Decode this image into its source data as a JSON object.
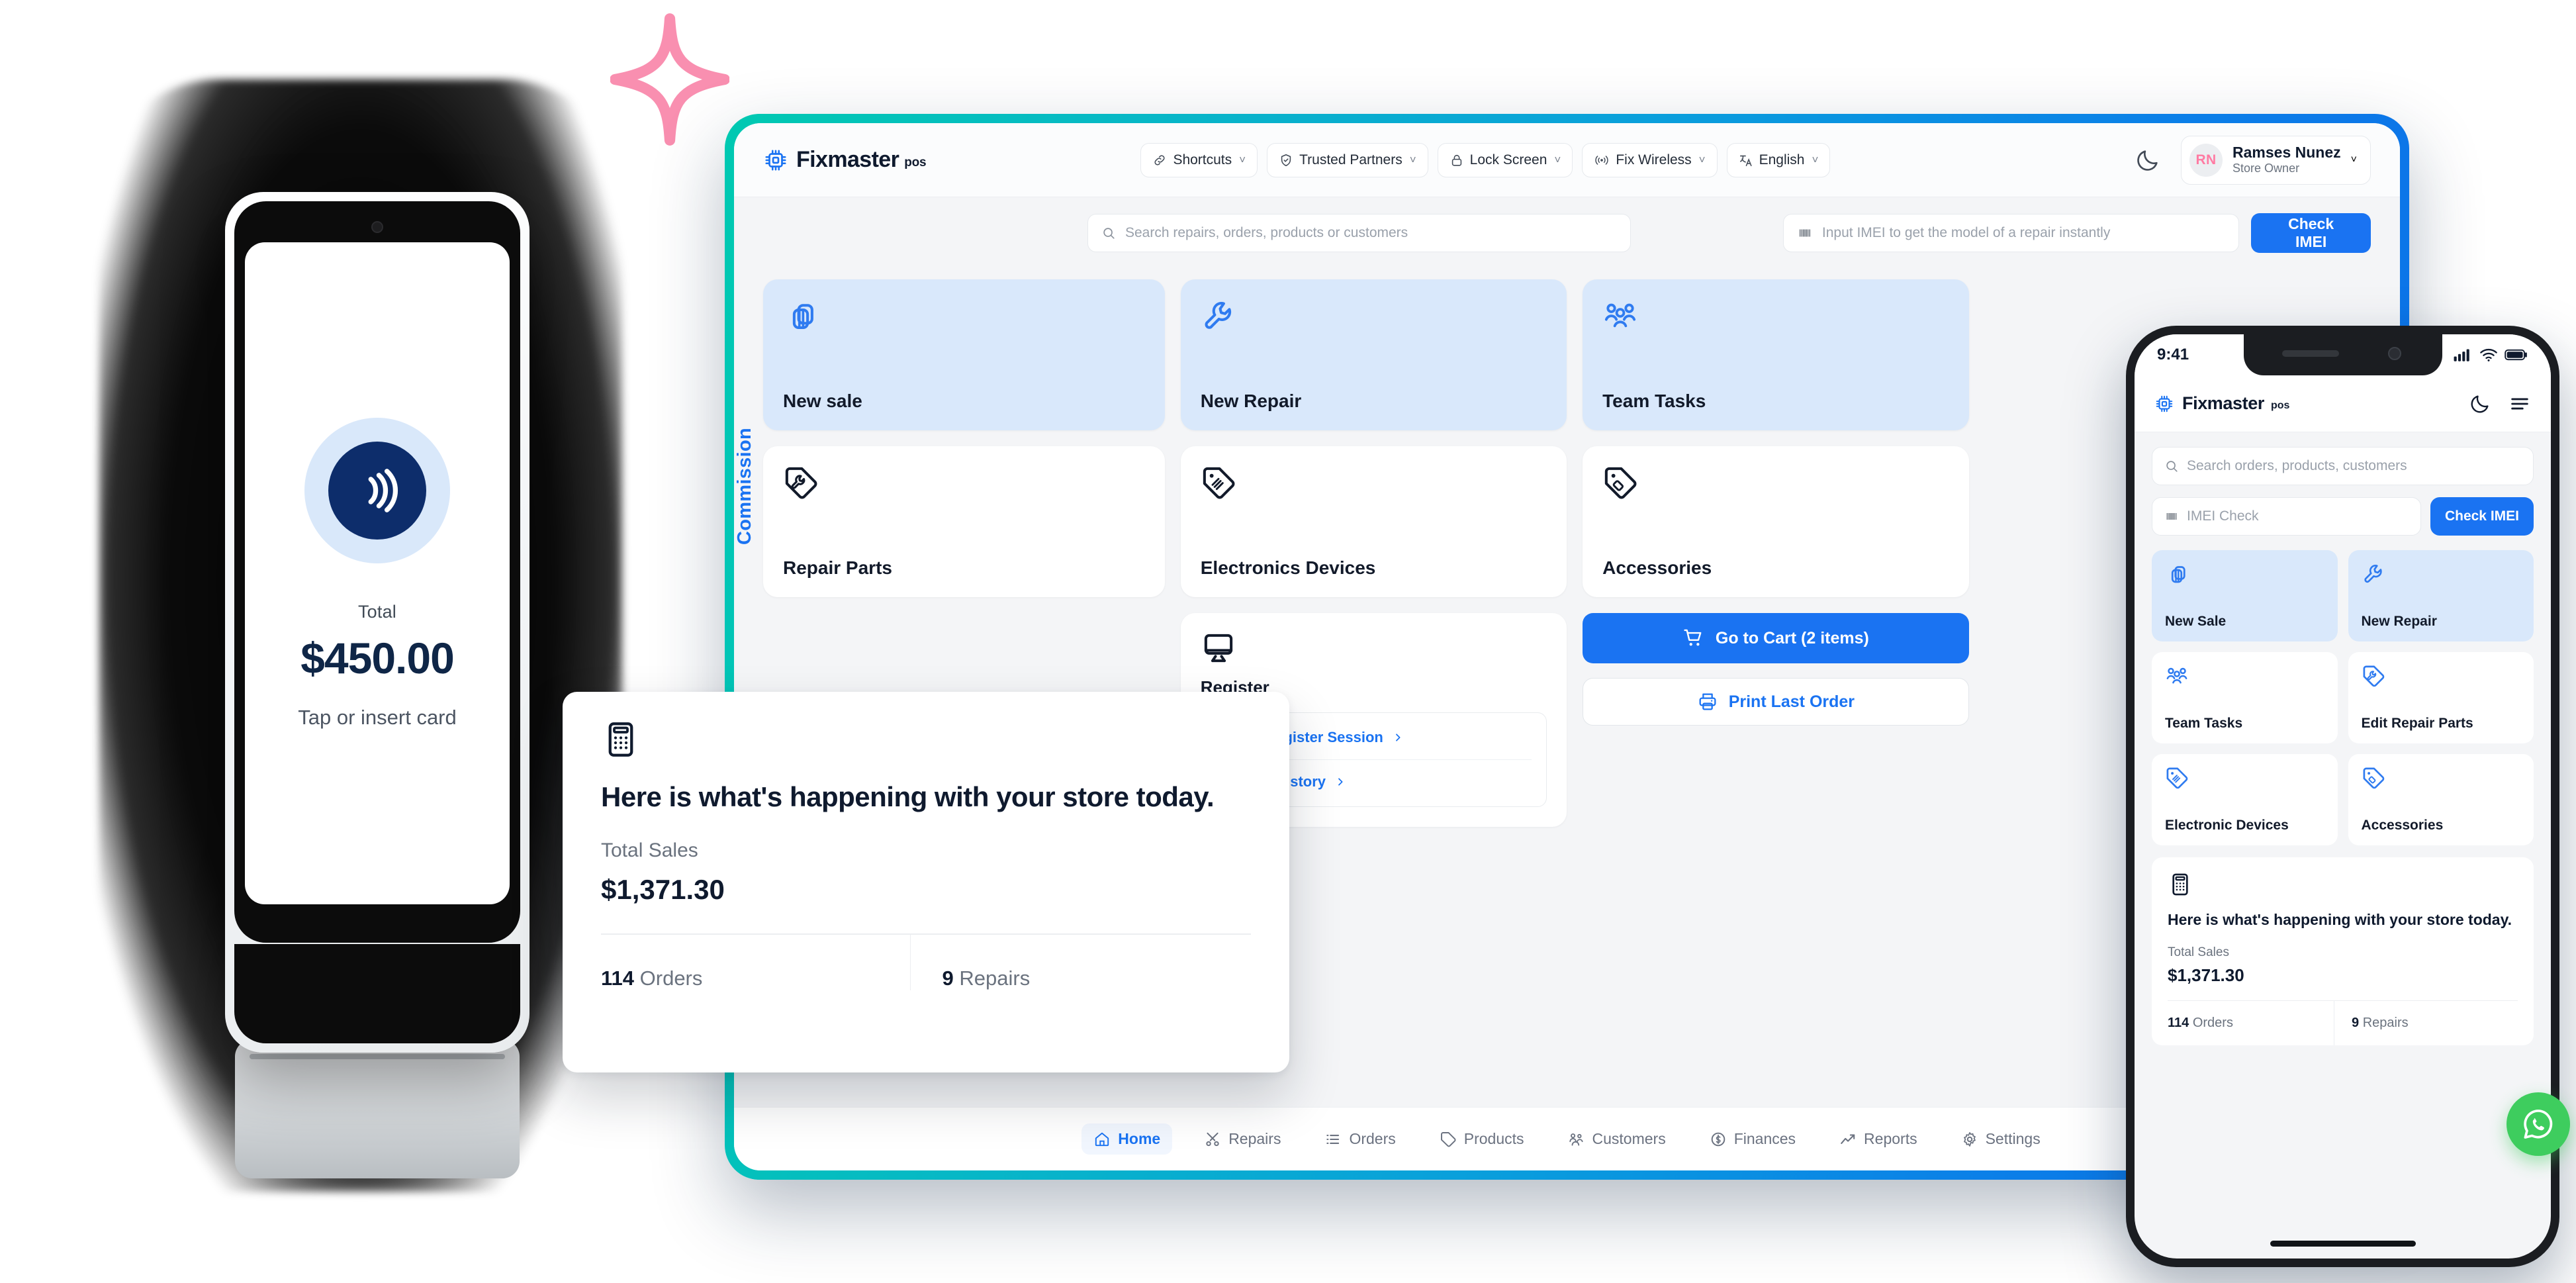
{
  "brand": {
    "name": "Fixmaster",
    "suffix": "pos"
  },
  "tablet": {
    "topnav": [
      {
        "label": "Shortcuts",
        "icon": "link-icon"
      },
      {
        "label": "Trusted Partners",
        "icon": "shield-check-icon"
      },
      {
        "label": "Lock Screen",
        "icon": "lock-icon"
      },
      {
        "label": "Fix Wireless",
        "icon": "wireless-signal-icon"
      },
      {
        "label": "English",
        "icon": "translate-icon"
      }
    ],
    "chevron": "˅",
    "user": {
      "initials": "RN",
      "name": "Ramses Nunez",
      "role": "Store Owner"
    },
    "search": {
      "placeholder": "Search repairs, orders, products or customers"
    },
    "imei": {
      "placeholder": "Input IMEI to get the model of a repair instantly",
      "button": "Check IMEI"
    },
    "side_tab": "Commission",
    "tiles": [
      {
        "label": "New sale",
        "icon": "bags-icon",
        "accent": true
      },
      {
        "label": "New Repair",
        "icon": "wrench-icon",
        "accent": true
      },
      {
        "label": "Team Tasks",
        "icon": "people-group-icon",
        "accent": true
      },
      {
        "label": "Repair Parts",
        "icon": "wrench-tag-icon",
        "accent": false
      },
      {
        "label": "Electronics Devices",
        "icon": "device-tag-icon",
        "accent": false
      },
      {
        "label": "Accessories",
        "icon": "accessory-tag-icon",
        "accent": false
      }
    ],
    "register": {
      "title": "Register",
      "icon": "monitor-icon",
      "links": [
        {
          "label": "Start a Register Session"
        },
        {
          "label": "Session History"
        }
      ]
    },
    "actions": {
      "cart": "Go to Cart (2 items)",
      "print": "Print Last Order"
    },
    "bottom_nav": [
      {
        "label": "Home",
        "icon": "home-icon",
        "active": true
      },
      {
        "label": "Repairs",
        "icon": "tools-icon",
        "active": false
      },
      {
        "label": "Orders",
        "icon": "list-icon",
        "active": false
      },
      {
        "label": "Products",
        "icon": "tag-icon",
        "active": false
      },
      {
        "label": "Customers",
        "icon": "users-icon",
        "active": false
      },
      {
        "label": "Finances",
        "icon": "dollar-circle-icon",
        "active": false
      },
      {
        "label": "Reports",
        "icon": "trend-up-icon",
        "active": false
      },
      {
        "label": "Settings",
        "icon": "gear-icon",
        "active": false
      }
    ]
  },
  "popup": {
    "icon": "calculator-icon",
    "headline": "Here is what's happening with your store today.",
    "total_sales_label": "Total Sales",
    "total_sales_value": "$1,371.30",
    "orders_count": "114",
    "orders_label": "Orders",
    "repairs_count": "9",
    "repairs_label": "Repairs"
  },
  "terminal": {
    "icon": "contactless-icon",
    "total_label": "Total",
    "amount": "$450.00",
    "hint": "Tap or insert card"
  },
  "phone": {
    "status": {
      "time": "9:41",
      "signal": "cellular-bars-icon",
      "wifi": "wifi-icon",
      "battery": "battery-icon"
    },
    "search": {
      "placeholder": "Search orders, products, customers"
    },
    "imei": {
      "placeholder": "IMEI Check",
      "button": "Check IMEI"
    },
    "tiles": [
      {
        "label": "New Sale",
        "icon": "bags-icon",
        "accent": true
      },
      {
        "label": "New Repair",
        "icon": "wrench-icon",
        "accent": true
      },
      {
        "label": "Team Tasks",
        "icon": "people-group-icon",
        "accent": false
      },
      {
        "label": "Edit Repair Parts",
        "icon": "wrench-tag-icon",
        "accent": false
      },
      {
        "label": "Electronic Devices",
        "icon": "device-tag-icon",
        "accent": false
      },
      {
        "label": "Accessories",
        "icon": "accessory-tag-icon",
        "accent": false
      }
    ],
    "card": {
      "icon": "calculator-icon",
      "headline": "Here is what's happening with your store today.",
      "total_sales_label": "Total Sales",
      "total_sales_value": "$1,371.30",
      "orders_count": "114",
      "orders_label": "Orders",
      "repairs_count": "9",
      "repairs_label": "Repairs"
    },
    "fab": {
      "icon": "whatsapp-icon"
    }
  },
  "colors": {
    "accent_blue": "#1a73f2",
    "tile_blue": "#d9e8fb",
    "tablet_edge_from": "#00c9b1",
    "tablet_edge_to": "#0c6fe9",
    "navy": "#0f2647",
    "sparkle_pink": "#f98fb0",
    "whatsapp_green": "#3ecd5e",
    "avatar_pink": "#ff7ba3"
  }
}
